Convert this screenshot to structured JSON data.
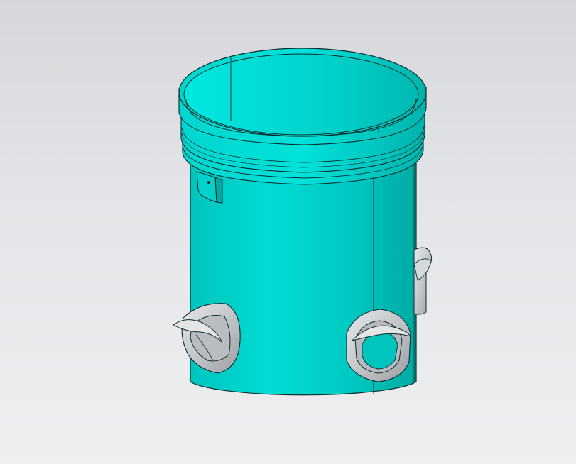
{
  "viewport": {
    "background_top": "#d6d7da",
    "background_bottom": "#eeeff1"
  },
  "model": {
    "body_color": "#00c8c2",
    "body_highlight": "#00e4dc",
    "body_shadow": "#00a9a3",
    "edge_color": "#0f2b2a",
    "fitting_color": "#c7cacd",
    "fitting_shadow": "#8b9094"
  }
}
